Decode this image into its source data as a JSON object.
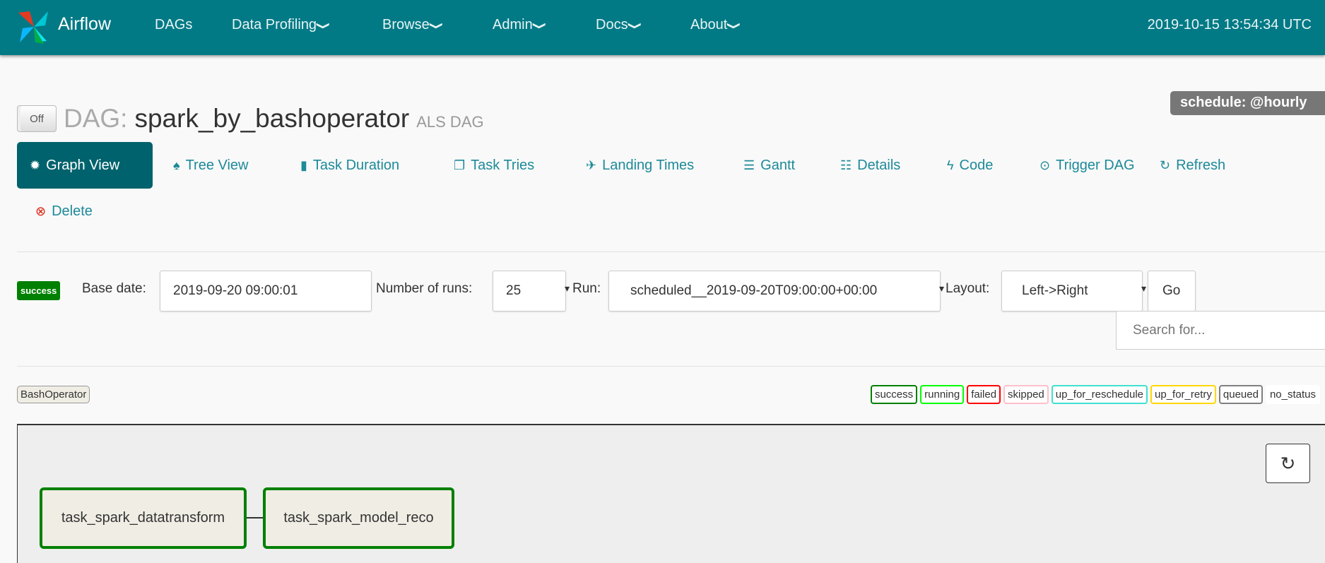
{
  "navbar": {
    "brand": "Airflow",
    "items": [
      {
        "label": "DAGs",
        "dropdown": false
      },
      {
        "label": "Data Profiling",
        "dropdown": true
      },
      {
        "label": "Browse",
        "dropdown": true
      },
      {
        "label": "Admin",
        "dropdown": true
      },
      {
        "label": "Docs",
        "dropdown": true
      },
      {
        "label": "About",
        "dropdown": true
      }
    ],
    "timestamp": "2019-10-15 13:54:34 UTC"
  },
  "dag": {
    "toggle": "Off",
    "prefix": "DAG:",
    "name": "spark_by_bashoperator",
    "description": "ALS DAG",
    "schedule": "schedule: @hourly"
  },
  "tabs": [
    {
      "label": "Graph View",
      "icon": "sun-icon",
      "active": true
    },
    {
      "label": "Tree View",
      "icon": "tree-icon"
    },
    {
      "label": "Task Duration",
      "icon": "bar-chart-icon"
    },
    {
      "label": "Task Tries",
      "icon": "files-icon"
    },
    {
      "label": "Landing Times",
      "icon": "plane-icon"
    },
    {
      "label": "Gantt",
      "icon": "gantt-icon"
    },
    {
      "label": "Details",
      "icon": "list-icon"
    },
    {
      "label": "Code",
      "icon": "flash-icon"
    },
    {
      "label": "Trigger DAG",
      "icon": "play-circle-icon"
    },
    {
      "label": "Refresh",
      "icon": "refresh-icon"
    },
    {
      "label": "Delete",
      "icon": "remove-circle-icon"
    }
  ],
  "form": {
    "state_badge": "success",
    "base_date_label": "Base date:",
    "base_date": "2019-09-20 09:00:01",
    "num_runs_label": "Number of runs:",
    "num_runs": "25",
    "run_label": "Run:",
    "run": "scheduled__2019-09-20T09:00:00+00:00",
    "layout_label": "Layout:",
    "layout": "Left->Right",
    "go": "Go",
    "search_placeholder": "Search for..."
  },
  "operators": [
    "BashOperator"
  ],
  "legend": [
    {
      "label": "success",
      "color": "#008000"
    },
    {
      "label": "running",
      "color": "#00ff00"
    },
    {
      "label": "failed",
      "color": "#ff0000"
    },
    {
      "label": "skipped",
      "color": "#ffc0cb"
    },
    {
      "label": "up_for_reschedule",
      "color": "#40e0d0"
    },
    {
      "label": "up_for_retry",
      "color": "#ffd700"
    },
    {
      "label": "queued",
      "color": "#808080"
    },
    {
      "label": "no_status",
      "color": "#ffffff"
    }
  ],
  "graph": {
    "nodes": [
      "task_spark_datatransform",
      "task_spark_model_reco"
    ]
  }
}
